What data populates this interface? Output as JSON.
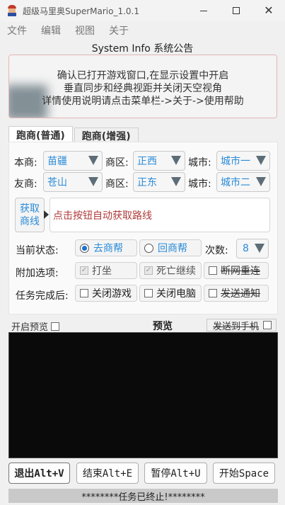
{
  "window": {
    "title": "超级马里奥SuperMario_1.0.1",
    "close_glyph": "✕"
  },
  "menu": [
    "文件",
    "编辑",
    "视图",
    "关于"
  ],
  "system_info": {
    "title": "System Info 系统公告",
    "lines": [
      "确认已打开游戏窗口,在显示设置中开启",
      "垂直同步和经典视距并关闭天空视角",
      "详情使用说明请点击菜单栏->关于->使用帮助"
    ]
  },
  "tabs": [
    {
      "label": "跑商(普通)",
      "active": true
    },
    {
      "label": "跑商(增强)",
      "active": false
    }
  ],
  "rows": {
    "own": {
      "label": "本商:",
      "faction": "苗疆",
      "zone_label": "商区:",
      "zone": "正西",
      "city_label": "城市:",
      "city": "城市一"
    },
    "friend": {
      "label": "友商:",
      "faction": "苍山",
      "zone_label": "商区:",
      "zone": "正东",
      "city_label": "城市:",
      "city": "城市二"
    }
  },
  "auto_route": {
    "button_label": "获取商线",
    "text": "点击按钮自动获取路线"
  },
  "status": {
    "label": "当前状态:",
    "options": [
      {
        "label": "去商帮",
        "selected": true
      },
      {
        "label": "回商帮",
        "selected": false
      }
    ],
    "count_label": "次数:",
    "count": "8"
  },
  "extra": {
    "label": "附加选项:",
    "options": [
      {
        "label": "打坐",
        "checked": true,
        "disabled": true
      },
      {
        "label": "死亡继续",
        "checked": true,
        "disabled": true
      },
      {
        "label": "断网重连",
        "checked": false,
        "disabled": false,
        "strikethrough": true
      }
    ]
  },
  "on_complete": {
    "label": "任务完成后:",
    "options": [
      {
        "label": "关闭游戏",
        "checked": false
      },
      {
        "label": "关闭电脑",
        "checked": false
      },
      {
        "label": "发送通知",
        "checked": false,
        "strikethrough": true
      }
    ]
  },
  "preview": {
    "enable_label": "开启预览",
    "title": "预览",
    "send_label": "发送到手机",
    "check_mark": "✓"
  },
  "buttons": {
    "exit": "退出Alt+V",
    "stop": "结束Alt+E",
    "pause": "暂停Alt+U",
    "start": "开始Space"
  },
  "statusbar": "********任务已终止!********",
  "colors": {
    "accent": "#2a8bd8",
    "route_text": "#b03a3a",
    "radio_on": "#1f6fd0",
    "notice_border": "#e7b5b5"
  }
}
